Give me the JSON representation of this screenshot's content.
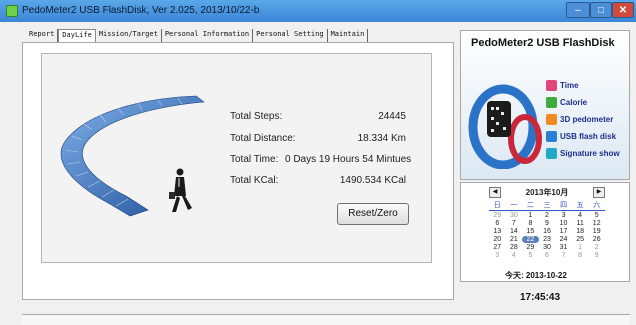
{
  "window": {
    "title": "PedoMeter2 USB FlashDisk, Ver 2.025, 2013/10/22-b",
    "controls": {
      "minimize": "–",
      "maximize": "□",
      "close": "✕"
    }
  },
  "tabs": [
    {
      "label": "Report",
      "active": false
    },
    {
      "label": "DayLife",
      "active": true
    },
    {
      "label": "Mission/Target",
      "active": false
    },
    {
      "label": "Personal Information",
      "active": false
    },
    {
      "label": "Personal Setting",
      "active": false
    },
    {
      "label": "Maintain",
      "active": false
    }
  ],
  "stats": {
    "steps_label": "Total Steps:",
    "steps_value": "24445",
    "distance_label": "Total Distance:",
    "distance_value": "18.334 Km",
    "time_label": "Total Time:",
    "time_value": "0 Days 19 Hours 54 Mintues",
    "kcal_label": "Total KCal:",
    "kcal_value": "1490.534 KCal"
  },
  "reset_button": "Reset/Zero",
  "promo": {
    "title": "PedoMeter2 USB FlashDisk",
    "features": [
      {
        "label": "Time",
        "icon": "clock-icon",
        "color": "#e0457b"
      },
      {
        "label": "Calorie",
        "icon": "flame-icon",
        "color": "#3caa3c"
      },
      {
        "label": "3D pedometer",
        "icon": "runner-icon",
        "color": "#f08a24"
      },
      {
        "label": "USB flash disk",
        "icon": "usb-icon",
        "color": "#2a7fd4"
      },
      {
        "label": "Signature show",
        "icon": "signature-icon",
        "color": "#24a8c8"
      }
    ]
  },
  "calendar": {
    "prev": "◀",
    "next": "▶",
    "month_label": "2013年10月",
    "weekdays": [
      "日",
      "一",
      "二",
      "三",
      "四",
      "五",
      "六"
    ],
    "days": [
      "29",
      "30",
      "1",
      "2",
      "3",
      "4",
      "5",
      "6",
      "7",
      "8",
      "9",
      "10",
      "11",
      "12",
      "13",
      "14",
      "15",
      "16",
      "17",
      "18",
      "19",
      "20",
      "21",
      "22",
      "23",
      "24",
      "25",
      "26",
      "27",
      "28",
      "29",
      "30",
      "31",
      "1",
      "2",
      "3",
      "4",
      "5",
      "6",
      "7",
      "8",
      "9"
    ],
    "today_index": 23,
    "today_line": "今天: 2013-10-22"
  },
  "clock": "17:45:43"
}
